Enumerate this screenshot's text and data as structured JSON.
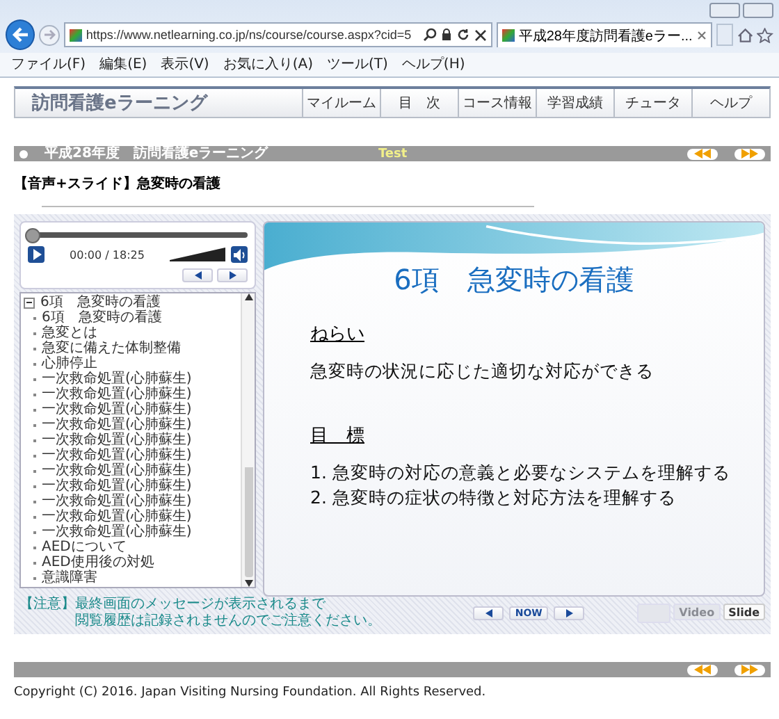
{
  "browser": {
    "url": "https://www.netlearning.co.jp/ns/course/course.aspx?cid=5",
    "tab_title": "平成28年度訪問看護eラー...",
    "menu": [
      "ファイル(F)",
      "編集(E)",
      "表示(V)",
      "お気に入り(A)",
      "ツール(T)",
      "ヘルプ(H)"
    ]
  },
  "site": {
    "logo": "訪問看護eラーニング",
    "nav": [
      "マイルーム",
      "目　次",
      "コース情報",
      "学習成績",
      "チュータ",
      "ヘルプ"
    ]
  },
  "course_bar": {
    "title": "平成28年度　訪問看護eラーニング",
    "mode": "Test"
  },
  "lesson_title": "【音声+スライド】急変時の看護",
  "player": {
    "progress": {
      "level": 0
    },
    "time": "00:00 / 18:25",
    "volume": {
      "level": 1
    }
  },
  "tree": {
    "label": "6項　急変時の看護",
    "expanded": true,
    "children": [
      {
        "label": "6項　急変時の看護"
      },
      {
        "label": "急変とは"
      },
      {
        "label": "急変に備えた体制整備"
      },
      {
        "label": "心肺停止"
      },
      {
        "label": "一次救命処置(心肺蘇生)"
      },
      {
        "label": "一次救命処置(心肺蘇生)"
      },
      {
        "label": "一次救命処置(心肺蘇生)"
      },
      {
        "label": "一次救命処置(心肺蘇生)"
      },
      {
        "label": "一次救命処置(心肺蘇生)"
      },
      {
        "label": "一次救命処置(心肺蘇生)"
      },
      {
        "label": "一次救命処置(心肺蘇生)"
      },
      {
        "label": "一次救命処置(心肺蘇生)"
      },
      {
        "label": "一次救命処置(心肺蘇生)"
      },
      {
        "label": "一次救命処置(心肺蘇生)"
      },
      {
        "label": "一次救命処置(心肺蘇生)"
      },
      {
        "label": "AEDについて"
      },
      {
        "label": "AED使用後の対処"
      },
      {
        "label": "意識障害"
      }
    ]
  },
  "notice": {
    "label": "【注意】",
    "lines": [
      "最終画面のメッセージが表示されるまで",
      "閲覧履歴は記録されませんのでご注意ください。"
    ]
  },
  "slide": {
    "title": "6項　急変時の看護",
    "sections": [
      {
        "heading": "ねらい",
        "lines": [
          "急変時の状況に応じた適切な対応ができる"
        ]
      },
      {
        "heading": "目　標",
        "lines": [
          "1. 急変時の対応の意義と必要なシステムを理解する",
          "2. 急変時の症状の特徴と対応方法を理解する"
        ]
      }
    ]
  },
  "slide_nav": {
    "now": "NOW"
  },
  "view_modes": [
    {
      "label": "Video",
      "disabled": true
    },
    {
      "label": "Slide",
      "disabled": false
    }
  ],
  "copyright": "Copyright (C) 2016. Japan Visiting Nursing Foundation. All Rights Reserved."
}
